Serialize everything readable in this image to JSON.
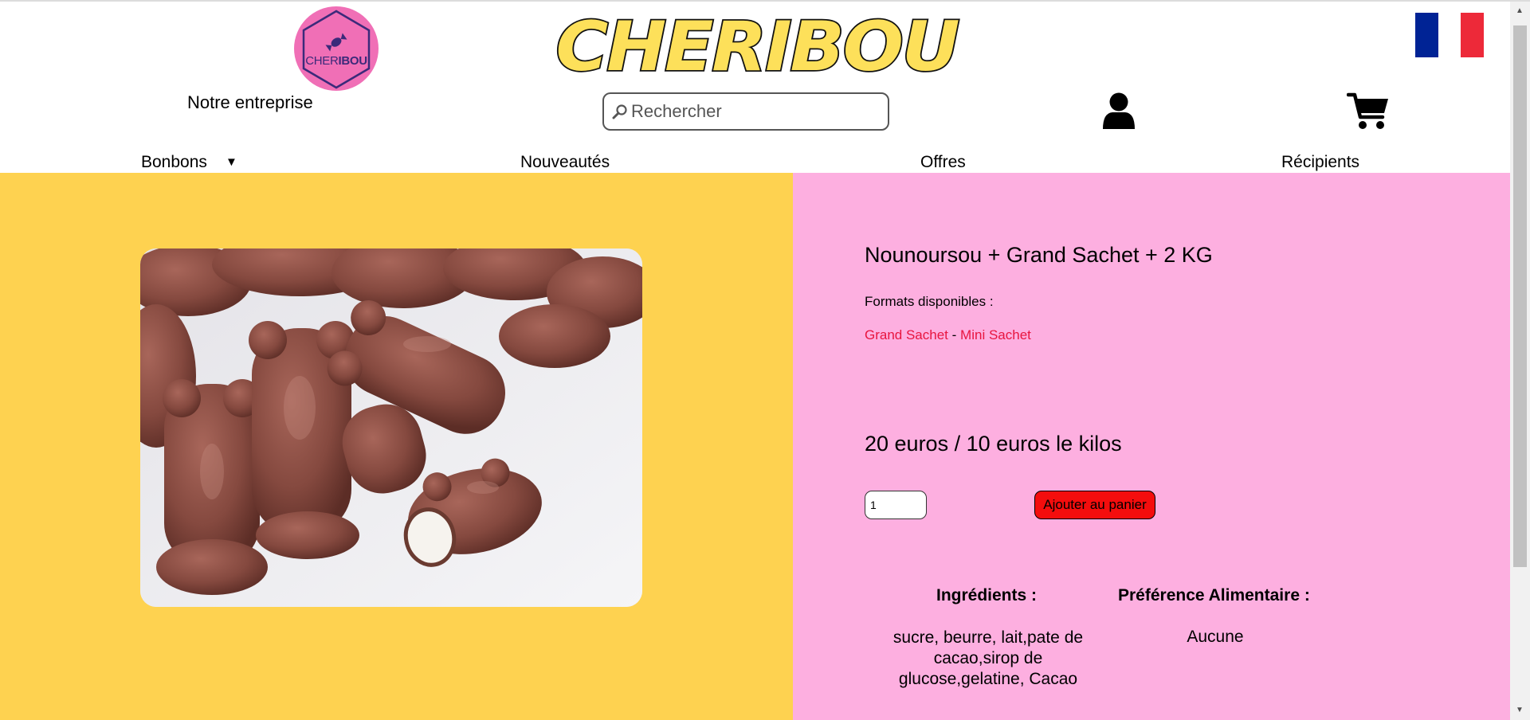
{
  "header": {
    "logo_text_light": "CHER",
    "logo_text_bold": "IBOU",
    "brand_title": "CHERIBOU",
    "company_link": "Notre entreprise",
    "search": {
      "placeholder": "Rechercher"
    },
    "flag_colors": [
      "#002395",
      "#ffffff",
      "#ed2939"
    ],
    "icons": [
      "search-icon",
      "user-icon",
      "cart-icon",
      "candy-icon"
    ]
  },
  "nav": {
    "items": [
      "Bonbons",
      "Nouveautés",
      "Offres",
      "Récipients"
    ],
    "dropdown_caret": "▼"
  },
  "product": {
    "title": "Nounoursou + Grand Sachet + 2 KG",
    "formats_label": "Formats disponibles :",
    "formats": [
      "Grand Sachet",
      "Mini Sachet"
    ],
    "formats_separator": "-",
    "price": "20 euros / 10 euros le kilos",
    "quantity": "1",
    "add_to_cart_label": "Ajouter au panier",
    "ingredients_heading": "Ingrédients :",
    "ingredients": "sucre, beurre, lait,pate de cacao,sirop de glucose,gelatine, Cacao",
    "preference_heading": "Préférence Alimentaire :",
    "preference": "Aucune"
  },
  "colors": {
    "left_panel": "#fed250",
    "right_panel": "#fdafe0",
    "brand_yellow": "#fde05a",
    "logo_pink": "#f06fb6",
    "link_red": "#e8153f",
    "button_red": "#f40d0d"
  }
}
